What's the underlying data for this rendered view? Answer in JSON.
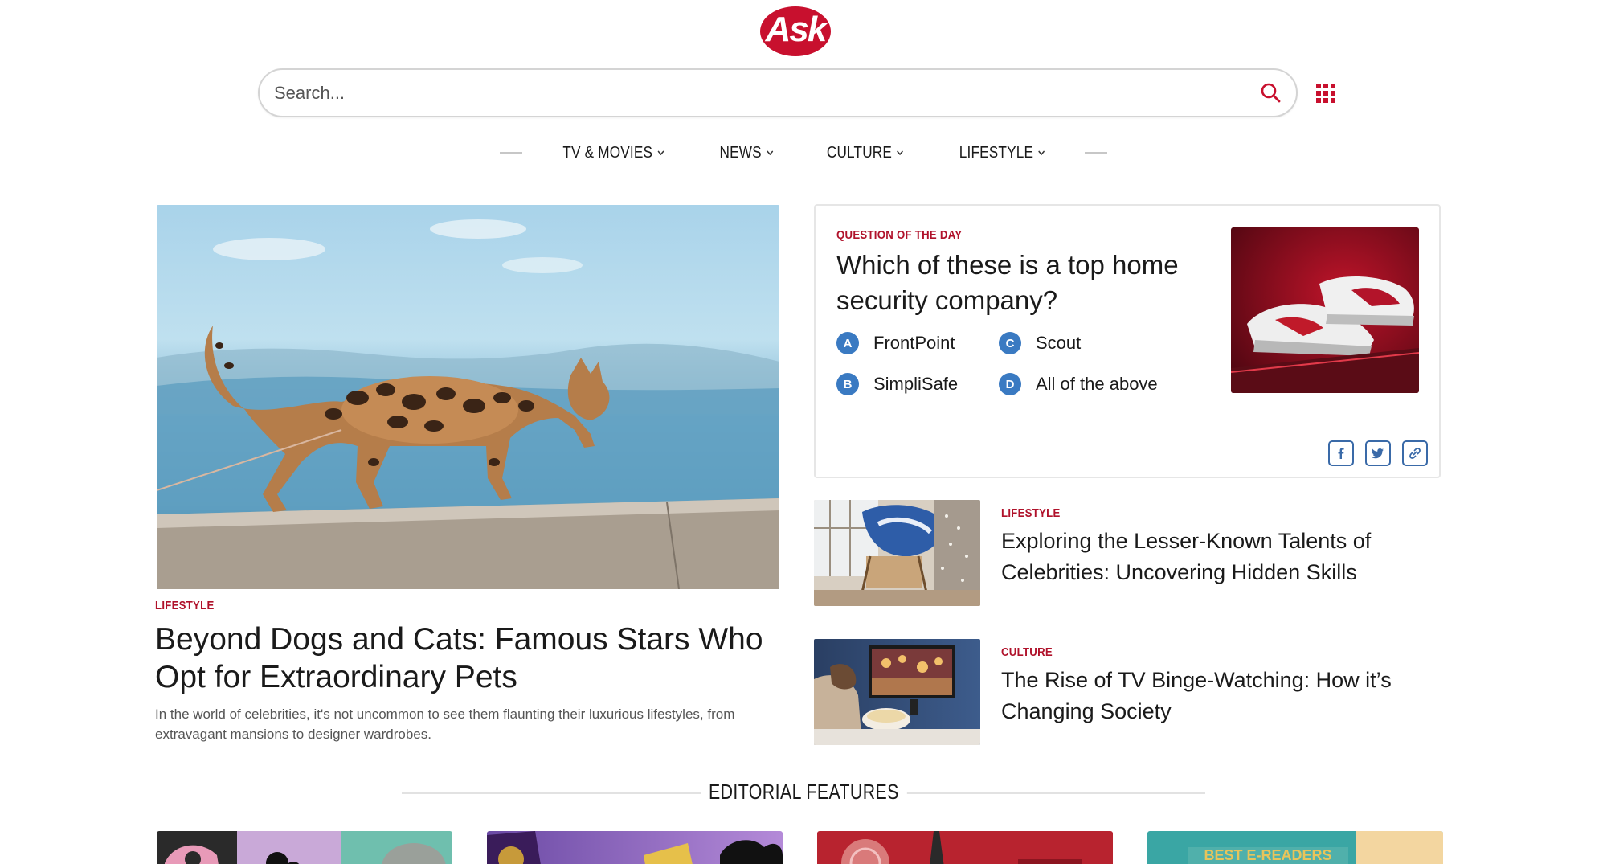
{
  "brand": {
    "logo_text": "Ask",
    "accent": "#c8102e",
    "kicker_color": "#b0122b"
  },
  "search": {
    "placeholder": "Search..."
  },
  "nav": {
    "items": [
      "TV & MOVIES",
      "NEWS",
      "CULTURE",
      "LIFESTYLE"
    ]
  },
  "hero": {
    "category": "LIFESTYLE",
    "title": "Beyond Dogs and Cats: Famous Stars Who Opt for Extraordinary Pets",
    "description": "In the world of celebrities, it's not uncommon to see them flaunting their luxurious lifestyles, from extravagant mansions to designer wardrobes."
  },
  "question": {
    "kicker": "QUESTION OF THE DAY",
    "title": "Which of these is a top home security company?",
    "options": [
      {
        "letter": "A",
        "label": "FrontPoint"
      },
      {
        "letter": "C",
        "label": "Scout"
      },
      {
        "letter": "B",
        "label": "SimpliSafe"
      },
      {
        "letter": "D",
        "label": "All of the above"
      }
    ]
  },
  "side_articles": [
    {
      "category": "LIFESTYLE",
      "title": "Exploring the Lesser-Known Talents of Celebrities: Uncovering Hidden Skills"
    },
    {
      "category": "CULTURE",
      "title": "The Rise of TV Binge-Watching: How it’s Changing Society"
    }
  ],
  "editorial": {
    "heading": "EDITORIAL FEATURES",
    "card4_text": "BEST E-READERS"
  },
  "icons": {
    "search": "search-icon",
    "apps": "grid-icon",
    "chevron": "chevron-down-icon",
    "facebook": "facebook-icon",
    "twitter": "twitter-icon",
    "link": "link-icon"
  }
}
